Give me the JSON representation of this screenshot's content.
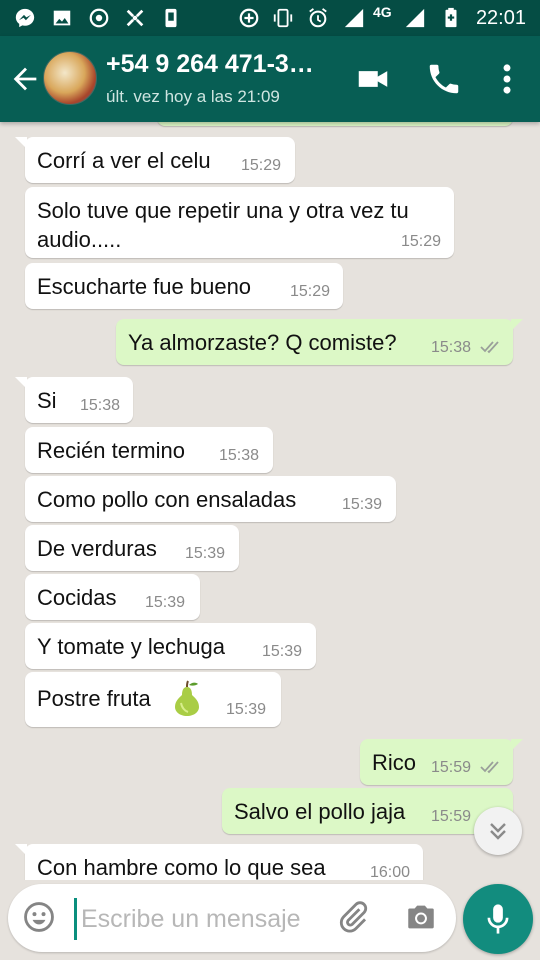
{
  "status_bar": {
    "time": "22:01",
    "network": "4G",
    "icons": [
      "messenger-icon",
      "gallery-icon",
      "chrome-icon",
      "tools-icon",
      "phone-status-icon",
      "data-saver-icon",
      "vibrate-icon",
      "alarm-icon",
      "signal-icon",
      "battery-charging-icon"
    ]
  },
  "header": {
    "contact_name": "+54 9 264 471-3…",
    "last_seen": "últ. vez hoy a las 21:09",
    "actions": [
      "video-call-icon",
      "call-icon",
      "more-icon"
    ]
  },
  "messages": [
    {
      "dir": "in",
      "text": "Corrí a ver el celu",
      "time": "15:29"
    },
    {
      "dir": "in",
      "text": "Solo tuve que repetir una y otra vez tu audio.....",
      "time": "15:29"
    },
    {
      "dir": "in",
      "text": "Escucharte fue bueno",
      "time": "15:29"
    },
    {
      "dir": "out",
      "text": "Ya almorzaste? Q comiste?",
      "time": "15:38",
      "status": "read"
    },
    {
      "dir": "in",
      "text": "Si",
      "time": "15:38"
    },
    {
      "dir": "in",
      "text": "Recién termino",
      "time": "15:38"
    },
    {
      "dir": "in",
      "text": "Como pollo con ensaladas",
      "time": "15:39"
    },
    {
      "dir": "in",
      "text": "De verduras",
      "time": "15:39"
    },
    {
      "dir": "in",
      "text": "Cocidas",
      "time": "15:39"
    },
    {
      "dir": "in",
      "text": "Y tomate y lechuga",
      "time": "15:39"
    },
    {
      "dir": "in",
      "text": "Postre fruta",
      "emoji": "pear-emoji",
      "time": "15:39"
    },
    {
      "dir": "out",
      "text": "Rico",
      "time": "15:59",
      "status": "read"
    },
    {
      "dir": "out",
      "text": "Salvo el pollo jaja",
      "time": "15:59",
      "status": "read"
    },
    {
      "dir": "in",
      "text": "Con hambre como lo que sea",
      "time": "16:00"
    }
  ],
  "composer": {
    "placeholder": "Escribe un mensaje",
    "icons": [
      "emoji-icon",
      "attach-icon",
      "camera-icon",
      "mic-icon"
    ]
  },
  "colors": {
    "app_bar": "#075e54",
    "status_bar": "#054d44",
    "outgoing_bubble": "#dcf8c6",
    "incoming_bubble": "#ffffff",
    "chat_background": "#e6e2dd",
    "accent": "#128c7e"
  }
}
